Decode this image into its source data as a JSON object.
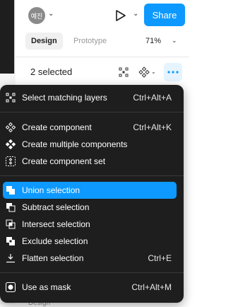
{
  "header": {
    "avatar_text": "예진",
    "share_label": "Share"
  },
  "tabs": {
    "design": "Design",
    "prototype": "Prototype",
    "zoom": "71%"
  },
  "selection": {
    "label": "2 selected"
  },
  "menu": {
    "items": [
      {
        "label": "Select matching layers",
        "shortcut": "Ctrl+Alt+A"
      },
      {
        "label": "Create component",
        "shortcut": "Ctrl+Alt+K"
      },
      {
        "label": "Create multiple components",
        "shortcut": ""
      },
      {
        "label": "Create component set",
        "shortcut": ""
      },
      {
        "label": "Union selection",
        "shortcut": ""
      },
      {
        "label": "Subtract selection",
        "shortcut": ""
      },
      {
        "label": "Intersect selection",
        "shortcut": ""
      },
      {
        "label": "Exclude selection",
        "shortcut": ""
      },
      {
        "label": "Flatten selection",
        "shortcut": "Ctrl+E"
      },
      {
        "label": "Use as mask",
        "shortcut": "Ctrl+Alt+M"
      }
    ]
  },
  "bottom": {
    "label": "Design"
  },
  "colors": {
    "accent": "#0d99ff",
    "menu_bg": "#1e1e1e"
  }
}
